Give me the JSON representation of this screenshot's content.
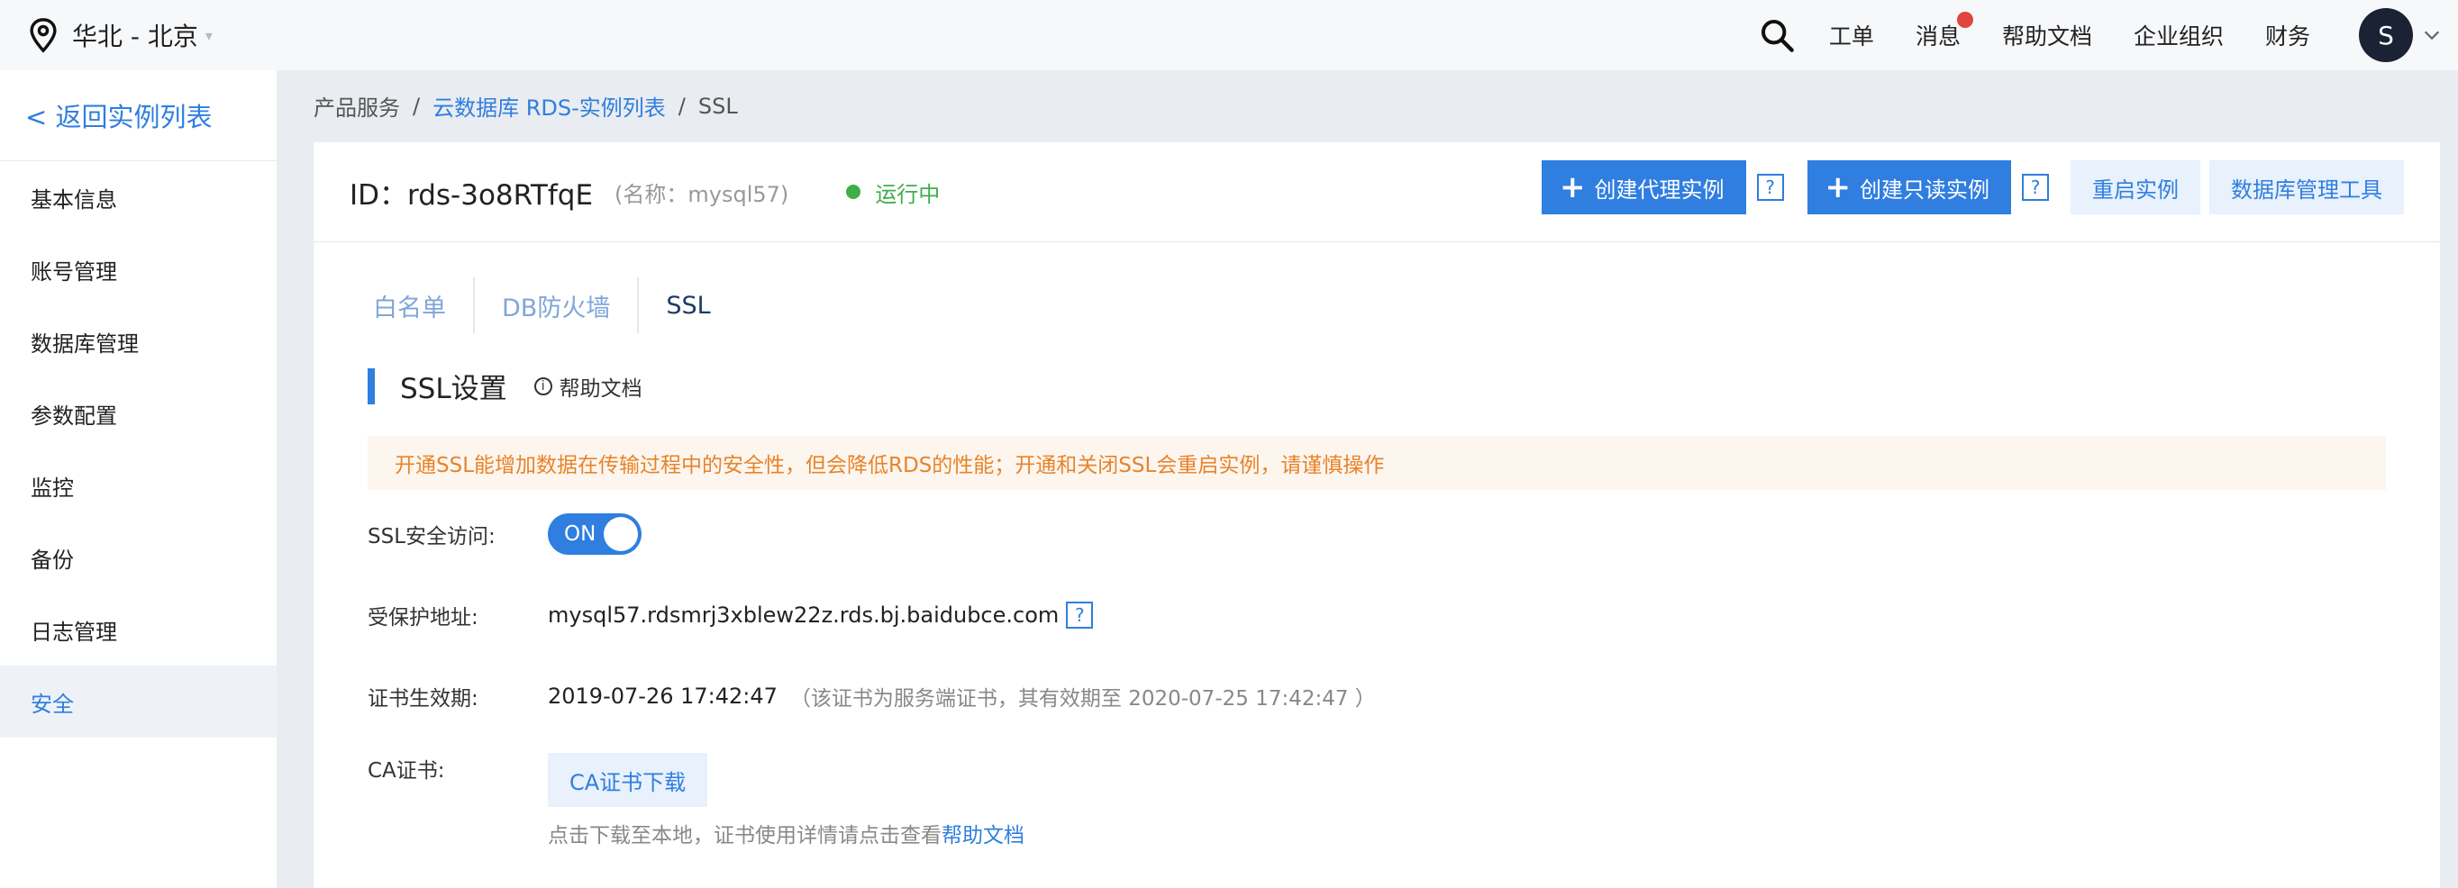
{
  "topbar": {
    "region": "华北 - 北京",
    "nav": [
      "工单",
      "消息",
      "帮助文档",
      "企业组织",
      "财务"
    ],
    "avatar_letter": "S"
  },
  "sidebar": {
    "back": "< 返回实例列表",
    "items": [
      "基本信息",
      "账号管理",
      "数据库管理",
      "参数配置",
      "监控",
      "备份",
      "日志管理",
      "安全"
    ],
    "active": "安全"
  },
  "breadcrumb": {
    "root": "产品服务",
    "sep": "/",
    "link": "云数据库 RDS-实例列表",
    "current": "SSL"
  },
  "instance": {
    "id_text": "ID：rds-3o8RTfqE",
    "name_text": "(名称：mysql57)",
    "status": "运行中"
  },
  "actions": {
    "create_proxy": "创建代理实例",
    "create_readonly": "创建只读实例",
    "help_mark": "?",
    "restart": "重启实例",
    "db_tool": "数据库管理工具"
  },
  "tabs": [
    "白名单",
    "DB防火墙",
    "SSL"
  ],
  "active_tab": "SSL",
  "section": {
    "title": "SSL设置",
    "help": "帮助文档"
  },
  "warning": "开通SSL能增加数据在传输过程中的安全性，但会降低RDS的性能；开通和关闭SSL会重启实例，请谨慎操作",
  "form": {
    "ssl_label": "SSL安全访问:",
    "ssl_toggle": "ON",
    "address_label": "受保护地址:",
    "address_value": "mysql57.rdsmrj3xblew22z.rds.bj.baidubce.com",
    "cert_label": "证书生效期:",
    "cert_value": "2019-07-26 17:42:47",
    "cert_note": "（该证书为服务端证书，其有效期至 2020-07-25 17:42:47 ）",
    "ca_label": "CA证书:",
    "ca_button": "CA证书下载",
    "ca_note": "点击下载至本地，证书使用详情请点击查看",
    "ca_note_link": "帮助文档"
  },
  "colors": {
    "primary": "#2f7ee0",
    "running": "#3fae49",
    "warning_text": "#e8832a",
    "warning_bg": "#fdf6ef"
  }
}
